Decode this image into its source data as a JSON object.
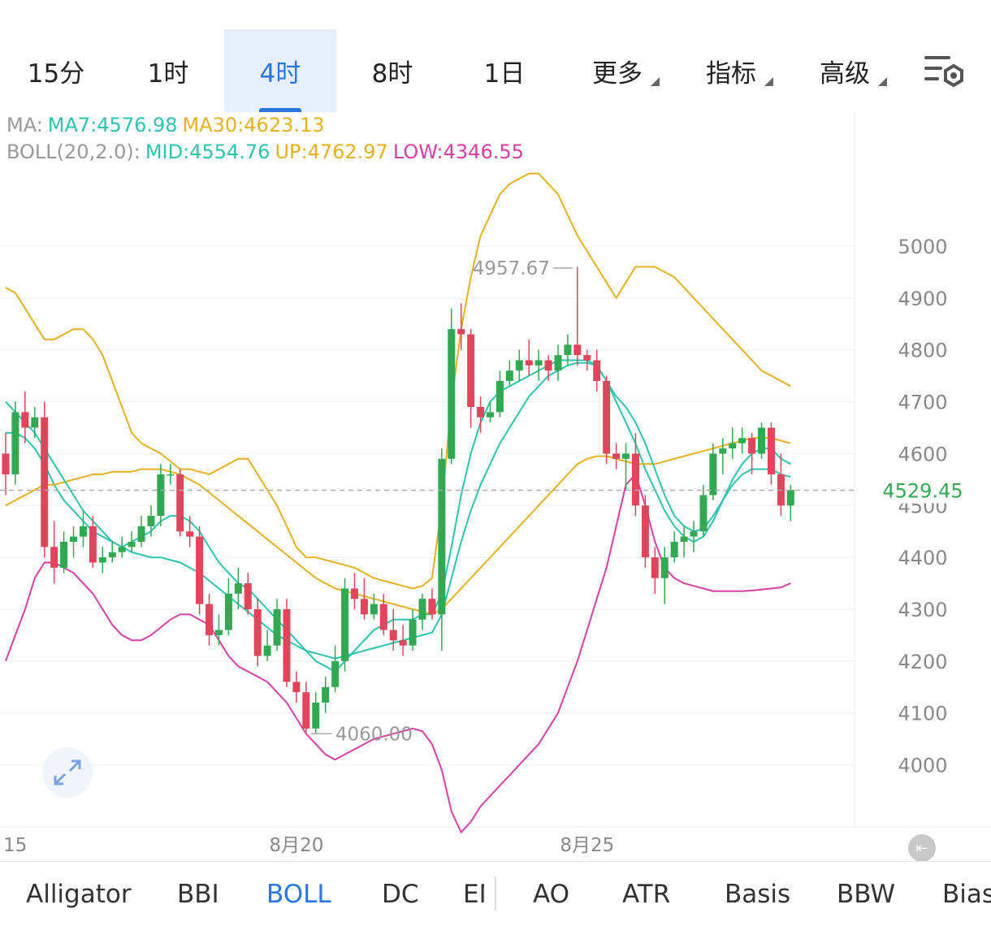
{
  "timeframe_tabs": [
    "15分",
    "1时",
    "4时",
    "8时",
    "1日"
  ],
  "active_tab": "4时",
  "dropdowns": [
    "更多",
    "指标",
    "高级"
  ],
  "legend": {
    "ma_prefix": "MA:",
    "ma7": "MA7:4576.98",
    "ma30": "MA30:4623.13",
    "boll_prefix": "BOLL(20,2.0):",
    "mid": "MID:4554.76",
    "up": "UP:4762.97",
    "low": "LOW:4346.55"
  },
  "colors": {
    "up_candle": "#33a853",
    "down_candle": "#e0455b",
    "ma7": "#2cc4ad",
    "ma30": "#e6b020",
    "boll_mid": "#2cc4ad",
    "boll_up": "#e6b020",
    "boll_low": "#d63fa4",
    "accent": "#2a76e0"
  },
  "chart_data": {
    "type": "candlestick",
    "ylim": [
      3880,
      5150
    ],
    "y_ticks": [
      4000,
      4100,
      4200,
      4300,
      4400,
      4500,
      4600,
      4700,
      4800,
      4900,
      5000
    ],
    "x_tick_labels": [
      "15",
      "8月20",
      "8月25"
    ],
    "x_tick_index": [
      0,
      30,
      60
    ],
    "current_price": "4529.45",
    "current_price_value": 4529.45,
    "high_marker": {
      "label": "4957.67",
      "index": 59,
      "value": 4957.67
    },
    "low_marker": {
      "label": "4060.00",
      "index": 31,
      "value": 4060.0
    },
    "candles": [
      [
        4600,
        4560,
        4640,
        4520
      ],
      [
        4560,
        4680,
        4700,
        4540
      ],
      [
        4680,
        4650,
        4720,
        4620
      ],
      [
        4650,
        4670,
        4690,
        4630
      ],
      [
        4670,
        4420,
        4700,
        4400
      ],
      [
        4420,
        4380,
        4470,
        4350
      ],
      [
        4380,
        4430,
        4450,
        4370
      ],
      [
        4430,
        4440,
        4460,
        4400
      ],
      [
        4440,
        4460,
        4490,
        4420
      ],
      [
        4460,
        4390,
        4480,
        4380
      ],
      [
        4390,
        4400,
        4420,
        4370
      ],
      [
        4400,
        4410,
        4430,
        4390
      ],
      [
        4410,
        4420,
        4440,
        4400
      ],
      [
        4420,
        4430,
        4450,
        4410
      ],
      [
        4430,
        4460,
        4480,
        4420
      ],
      [
        4460,
        4480,
        4500,
        4440
      ],
      [
        4480,
        4560,
        4580,
        4460
      ],
      [
        4560,
        4560,
        4580,
        4540
      ],
      [
        4560,
        4450,
        4570,
        4440
      ],
      [
        4450,
        4440,
        4480,
        4420
      ],
      [
        4440,
        4310,
        4460,
        4290
      ],
      [
        4310,
        4250,
        4330,
        4230
      ],
      [
        4250,
        4260,
        4290,
        4230
      ],
      [
        4260,
        4330,
        4360,
        4250
      ],
      [
        4330,
        4350,
        4380,
        4300
      ],
      [
        4350,
        4300,
        4370,
        4290
      ],
      [
        4300,
        4210,
        4320,
        4190
      ],
      [
        4210,
        4230,
        4260,
        4200
      ],
      [
        4230,
        4300,
        4320,
        4220
      ],
      [
        4300,
        4160,
        4320,
        4150
      ],
      [
        4160,
        4140,
        4180,
        4120
      ],
      [
        4140,
        4070,
        4160,
        4060
      ],
      [
        4070,
        4120,
        4140,
        4060
      ],
      [
        4120,
        4150,
        4170,
        4100
      ],
      [
        4150,
        4200,
        4230,
        4140
      ],
      [
        4200,
        4340,
        4360,
        4180
      ],
      [
        4340,
        4320,
        4370,
        4300
      ],
      [
        4320,
        4290,
        4360,
        4280
      ],
      [
        4290,
        4310,
        4330,
        4280
      ],
      [
        4310,
        4260,
        4330,
        4250
      ],
      [
        4260,
        4240,
        4300,
        4220
      ],
      [
        4240,
        4230,
        4270,
        4210
      ],
      [
        4230,
        4280,
        4300,
        4220
      ],
      [
        4280,
        4320,
        4330,
        4260
      ],
      [
        4320,
        4290,
        4340,
        4280
      ],
      [
        4290,
        4590,
        4610,
        4220
      ],
      [
        4590,
        4840,
        4880,
        4580
      ],
      [
        4840,
        4830,
        4890,
        4800
      ],
      [
        4830,
        4690,
        4840,
        4650
      ],
      [
        4690,
        4670,
        4710,
        4640
      ],
      [
        4670,
        4680,
        4700,
        4660
      ],
      [
        4680,
        4740,
        4760,
        4670
      ],
      [
        4740,
        4760,
        4780,
        4730
      ],
      [
        4760,
        4780,
        4800,
        4740
      ],
      [
        4780,
        4770,
        4820,
        4750
      ],
      [
        4770,
        4780,
        4800,
        4740
      ],
      [
        4780,
        4760,
        4790,
        4740
      ],
      [
        4760,
        4790,
        4810,
        4740
      ],
      [
        4790,
        4810,
        4830,
        4770
      ],
      [
        4810,
        4790,
        4960,
        4770
      ],
      [
        4790,
        4780,
        4800,
        4760
      ],
      [
        4780,
        4740,
        4800,
        4720
      ],
      [
        4740,
        4600,
        4750,
        4580
      ],
      [
        4600,
        4590,
        4620,
        4570
      ],
      [
        4590,
        4600,
        4620,
        4530
      ],
      [
        4600,
        4500,
        4640,
        4480
      ],
      [
        4500,
        4400,
        4520,
        4380
      ],
      [
        4400,
        4360,
        4420,
        4330
      ],
      [
        4360,
        4400,
        4420,
        4310
      ],
      [
        4400,
        4430,
        4450,
        4390
      ],
      [
        4430,
        4440,
        4460,
        4400
      ],
      [
        4440,
        4450,
        4470,
        4410
      ],
      [
        4450,
        4520,
        4540,
        4440
      ],
      [
        4520,
        4600,
        4620,
        4510
      ],
      [
        4600,
        4610,
        4630,
        4560
      ],
      [
        4610,
        4620,
        4650,
        4590
      ],
      [
        4620,
        4630,
        4650,
        4600
      ],
      [
        4630,
        4600,
        4640,
        4560
      ],
      [
        4600,
        4650,
        4660,
        4590
      ],
      [
        4650,
        4560,
        4660,
        4540
      ],
      [
        4560,
        4500,
        4600,
        4480
      ],
      [
        4500,
        4530,
        4540,
        4470
      ]
    ],
    "series": [
      {
        "name": "MA7",
        "values": [
          4640,
          4640,
          4630,
          4610,
          4580,
          4540,
          4510,
          4490,
          4470,
          4450,
          4440,
          4430,
          4420,
          4430,
          4440,
          4450,
          4470,
          4480,
          4480,
          4470,
          4450,
          4420,
          4390,
          4370,
          4350,
          4340,
          4320,
          4300,
          4280,
          4260,
          4240,
          4220,
          4200,
          4190,
          4180,
          4200,
          4220,
          4240,
          4260,
          4270,
          4280,
          4280,
          4280,
          4290,
          4290,
          4330,
          4420,
          4520,
          4600,
          4660,
          4700,
          4720,
          4730,
          4740,
          4750,
          4760,
          4770,
          4780,
          4780,
          4780,
          4780,
          4770,
          4740,
          4700,
          4660,
          4620,
          4570,
          4530,
          4490,
          4460,
          4440,
          4430,
          4440,
          4470,
          4510,
          4550,
          4580,
          4600,
          4610,
          4610,
          4590,
          4580
        ]
      },
      {
        "name": "MA30",
        "values": [
          4500,
          4510,
          4520,
          4530,
          4540,
          4540,
          4545,
          4550,
          4555,
          4560,
          4560,
          4565,
          4565,
          4565,
          4570,
          4570,
          4570,
          4565,
          4560,
          4550,
          4540,
          4525,
          4510,
          4495,
          4480,
          4465,
          4450,
          4435,
          4420,
          4405,
          4390,
          4375,
          4360,
          4350,
          4340,
          4335,
          4330,
          4325,
          4320,
          4315,
          4310,
          4305,
          4300,
          4295,
          4290,
          4300,
          4320,
          4340,
          4360,
          4380,
          4400,
          4420,
          4440,
          4460,
          4480,
          4500,
          4520,
          4540,
          4560,
          4580,
          4590,
          4595,
          4595,
          4590,
          4585,
          4580,
          4580,
          4580,
          4585,
          4590,
          4595,
          4600,
          4605,
          4610,
          4615,
          4620,
          4625,
          4630,
          4630,
          4630,
          4625,
          4620
        ]
      },
      {
        "name": "BOLL MID",
        "values": [
          4700,
          4680,
          4660,
          4640,
          4610,
          4580,
          4550,
          4520,
          4490,
          4470,
          4450,
          4430,
          4420,
          4410,
          4405,
          4400,
          4400,
          4395,
          4390,
          4380,
          4370,
          4355,
          4340,
          4325,
          4310,
          4295,
          4280,
          4265,
          4250,
          4240,
          4230,
          4220,
          4215,
          4210,
          4205,
          4210,
          4215,
          4220,
          4225,
          4230,
          4235,
          4240,
          4245,
          4250,
          4255,
          4290,
          4360,
          4430,
          4490,
          4540,
          4580,
          4620,
          4650,
          4680,
          4710,
          4730,
          4750,
          4760,
          4770,
          4775,
          4775,
          4770,
          4740,
          4710,
          4690,
          4660,
          4620,
          4570,
          4520,
          4480,
          4460,
          4450,
          4455,
          4480,
          4510,
          4540,
          4560,
          4570,
          4570,
          4570,
          4560,
          4555
        ]
      },
      {
        "name": "BOLL UP",
        "values": [
          4920,
          4910,
          4880,
          4850,
          4820,
          4820,
          4830,
          4840,
          4840,
          4820,
          4790,
          4740,
          4690,
          4640,
          4620,
          4610,
          4600,
          4585,
          4570,
          4570,
          4565,
          4560,
          4570,
          4580,
          4590,
          4590,
          4560,
          4530,
          4500,
          4460,
          4420,
          4400,
          4400,
          4395,
          4390,
          4385,
          4380,
          4370,
          4360,
          4355,
          4350,
          4345,
          4340,
          4345,
          4360,
          4500,
          4700,
          4840,
          4940,
          5020,
          5060,
          5100,
          5120,
          5130,
          5140,
          5140,
          5120,
          5100,
          5060,
          5020,
          4990,
          4960,
          4930,
          4900,
          4930,
          4960,
          4960,
          4960,
          4950,
          4940,
          4920,
          4900,
          4880,
          4860,
          4840,
          4820,
          4800,
          4780,
          4760,
          4750,
          4740,
          4730
        ]
      },
      {
        "name": "BOLL LOW",
        "values": [
          4200,
          4250,
          4300,
          4360,
          4390,
          4390,
          4380,
          4370,
          4350,
          4330,
          4300,
          4270,
          4250,
          4240,
          4240,
          4250,
          4265,
          4280,
          4290,
          4290,
          4280,
          4270,
          4240,
          4210,
          4190,
          4180,
          4170,
          4160,
          4140,
          4120,
          4090,
          4060,
          4040,
          4020,
          4010,
          4020,
          4030,
          4040,
          4050,
          4055,
          4060,
          4065,
          4070,
          4065,
          4040,
          3990,
          3910,
          3870,
          3890,
          3920,
          3940,
          3960,
          3980,
          4000,
          4020,
          4040,
          4070,
          4100,
          4150,
          4200,
          4260,
          4320,
          4380,
          4460,
          4540,
          4560,
          4500,
          4430,
          4380,
          4360,
          4350,
          4345,
          4340,
          4335,
          4335,
          4335,
          4335,
          4336,
          4338,
          4340,
          4342,
          4350
        ]
      }
    ]
  },
  "bottom_indicators": [
    "Alligator",
    "BBI",
    "BOLL",
    "DC",
    "EMA",
    "AO",
    "ATR",
    "Basis",
    "BBW",
    "Bias"
  ],
  "active_indicator": "BOLL"
}
